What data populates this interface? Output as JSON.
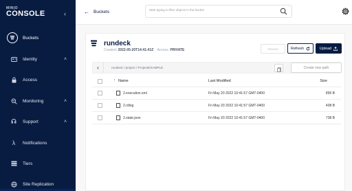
{
  "sidebar": {
    "logo_sub": "MIN|O",
    "logo_main": "CONSOLE",
    "items": [
      {
        "label": "Buckets",
        "icon": "bucket-icon",
        "active": true
      },
      {
        "label": "Identity",
        "icon": "identity-icon",
        "chevron": true
      },
      {
        "label": "Access",
        "icon": "lock-icon"
      },
      {
        "label": "Monitoring",
        "icon": "monitoring-icon",
        "chevron": true
      },
      {
        "label": "Support",
        "icon": "support-icon",
        "chevron": true
      },
      {
        "label": "Notifications",
        "icon": "lambda-icon"
      },
      {
        "label": "Tiers",
        "icon": "tiers-icon"
      },
      {
        "label": "Site Replication",
        "icon": "replication-icon"
      }
    ]
  },
  "topbar": {
    "back_label": "Buckets",
    "search_placeholder": "Start typing to filter objects in the bucket"
  },
  "bucket": {
    "name": "rundeck",
    "created_label": "Created:",
    "created_value": "2022-05-20T14:41:41Z",
    "access_label": "Access:",
    "access_value": "PRIVATE"
  },
  "actions": {
    "rewind_label": "Rewind",
    "refresh_label": "Refresh",
    "upload_label": "Upload"
  },
  "path": {
    "text": "rundeck / project / ProjectEXAMPLE",
    "new_path_label": "Create new path"
  },
  "table": {
    "headers": {
      "name": "Name",
      "modified": "Last Modified",
      "size": "Size"
    },
    "rows": [
      {
        "name": "2.execution.xml",
        "modified": "Fri May 20 2022 10:41:57 GMT-0400",
        "size": "895 B"
      },
      {
        "name": "2.rdlog",
        "modified": "Fri May 20 2022 10:41:57 GMT-0400",
        "size": "408 B"
      },
      {
        "name": "2.state.json",
        "modified": "Fri May 20 2022 10:41:57 GMT-0400",
        "size": "738 B"
      }
    ]
  },
  "colors": {
    "sidebar_bg": "#081c42",
    "accent": "#081c42"
  }
}
